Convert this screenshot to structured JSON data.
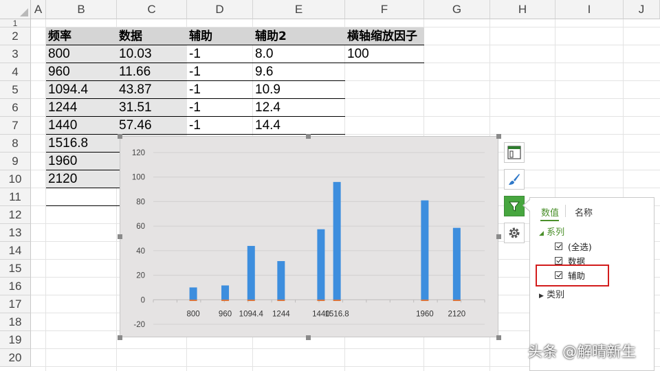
{
  "spreadsheet": {
    "columns": [
      "A",
      "B",
      "C",
      "D",
      "E",
      "F",
      "G",
      "H",
      "I",
      "J"
    ],
    "rows": [
      "1",
      "2",
      "3",
      "4",
      "5",
      "6",
      "7",
      "8",
      "9",
      "10",
      "11",
      "12",
      "13",
      "14",
      "15",
      "16",
      "17",
      "18",
      "19",
      "20"
    ],
    "table_headers": [
      "频率",
      "数据",
      "辅助",
      "辅助2",
      "横轴缩放因子"
    ],
    "table_rows": [
      [
        "800",
        "10.03",
        "-1",
        "8.0"
      ],
      [
        "960",
        "11.66",
        "-1",
        "9.6"
      ],
      [
        "1094.4",
        "43.87",
        "-1",
        "10.9"
      ],
      [
        "1244",
        "31.51",
        "-1",
        "12.4"
      ],
      [
        "1440",
        "57.46",
        "-1",
        "14.4"
      ],
      [
        "1516.8",
        "",
        "",
        ""
      ],
      [
        "1960",
        "",
        ""
      ],
      [
        "2120",
        "",
        ""
      ]
    ],
    "scale_factor": "100"
  },
  "chart_data": {
    "type": "bar",
    "categories": [
      "800",
      "960",
      "1094.4",
      "1244",
      "1440",
      "1516.8",
      "1960",
      "2120"
    ],
    "x_positions": [
      8.0,
      9.6,
      10.9,
      12.4,
      14.4,
      15.2,
      19.6,
      21.2
    ],
    "series": [
      {
        "name": "数据",
        "values": [
          10.03,
          11.66,
          43.87,
          31.51,
          57.46,
          96.0,
          81.0,
          58.6
        ],
        "color": "#3d8ede"
      },
      {
        "name": "辅助",
        "values": [
          -1,
          -1,
          -1,
          -1,
          -1,
          -1,
          -1,
          -1
        ],
        "color": "#e06c2a"
      }
    ],
    "ylim": [
      -20,
      120
    ],
    "yticks": [
      "-20",
      "0",
      "20",
      "40",
      "60",
      "80",
      "100",
      "120"
    ],
    "grid": true
  },
  "panel": {
    "tabs": [
      "数值",
      "名称"
    ],
    "series_group": "系列",
    "items": [
      "(全选)",
      "数据",
      "辅助"
    ],
    "category_group": "类别"
  },
  "watermark": "头条 @解晴新生",
  "colors": {
    "accent_green": "#47a63f",
    "bar_blue": "#3d8ede",
    "highlight_red": "#d21b1b"
  }
}
